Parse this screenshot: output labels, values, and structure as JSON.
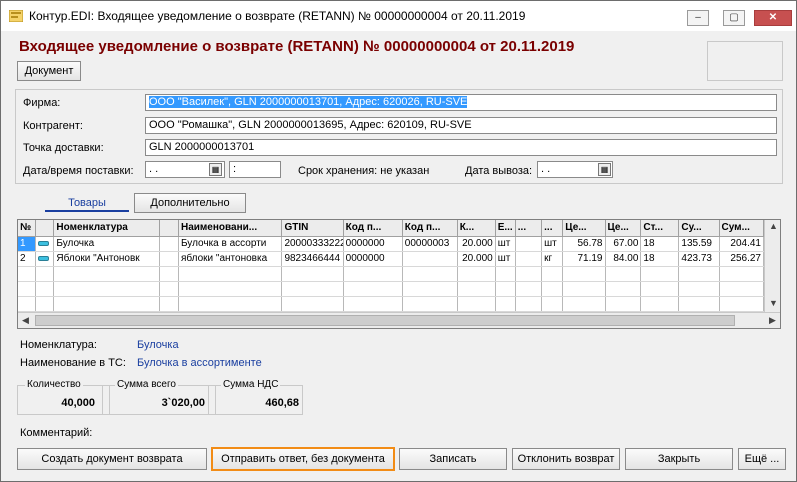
{
  "window": {
    "title": "Контур.EDI: Входящее уведомление о возврате (RETANN) № 00000000004 от 20.11.2019",
    "minimize": "–",
    "maximize": "▢",
    "close": "✕"
  },
  "header": {
    "title": "Входящее уведомление о возврате (RETANN) № 00000000004 от 20.11.2019",
    "document_button": "Документ"
  },
  "form": {
    "firm_label": "Фирма:",
    "firm_value": "ООО \"Василек\", GLN 2000000013701, Адрес: 620026, RU-SVE",
    "contractor_label": "Контрагент:",
    "contractor_value": "ООО \"Ромашка\", GLN 2000000013695, Адрес: 620109, RU-SVE",
    "delivery_point_label": "Точка доставки:",
    "delivery_point_value": "GLN 2000000013701",
    "delivery_datetime_label": "Дата/время поставки:",
    "delivery_date_value": " .  .",
    "delivery_time_value": " :",
    "storage_label": "Срок хранения: не указан",
    "pickup_date_label": "Дата вывоза:",
    "pickup_date_value": " .  ."
  },
  "tabs": [
    {
      "label": "Товары"
    },
    {
      "label": "Дополнительно"
    }
  ],
  "table": {
    "headers": [
      "№",
      "",
      "Номенклатура",
      "",
      "Наименовани...",
      "GTIN",
      "Код п...",
      "Код п...",
      "К...",
      "Е...",
      "...",
      "...",
      "Це...",
      "Це...",
      "Ст...",
      "Су...",
      "Сум..."
    ],
    "rows": [
      [
        "1",
        "",
        "Булочка",
        "",
        "Булочка в ассорти",
        "20000333222",
        "0000000",
        "00000003",
        "20.000",
        "шт",
        "",
        "шт",
        "56.78",
        "67.00",
        "18",
        "135.59",
        "204.41"
      ],
      [
        "2",
        "",
        "Яблоки \"Антоновк",
        "",
        "яблоки \"антоновка",
        "9823466444",
        "0000000",
        "",
        "20.000",
        "шт",
        "",
        "кг",
        "71.19",
        "84.00",
        "18",
        "423.73",
        "256.27"
      ]
    ]
  },
  "details": {
    "nomenclature_label": "Номенклатура:",
    "nomenclature_value": "Булочка",
    "name_label": "Наименование в ТС:",
    "name_value": "Булочка в ассортименте"
  },
  "totals": {
    "quantity_label": "Количество",
    "quantity_value": "40,000",
    "sum_label": "Сумма всего",
    "sum_value": "3`020,00",
    "vat_label": "Сумма НДС",
    "vat_value": "460,68"
  },
  "comment_label": "Комментарий:",
  "actions": {
    "create_return": "Создать документ возврата",
    "send_answer": "Отправить ответ, без документа",
    "save": "Записать",
    "reject_return": "Отклонить возврат",
    "close": "Закрыть",
    "more": "Ещё ..."
  },
  "colors": {
    "title_red": "#7a0000",
    "selection_blue": "#3399ff",
    "highlight_orange": "#f28c16"
  }
}
